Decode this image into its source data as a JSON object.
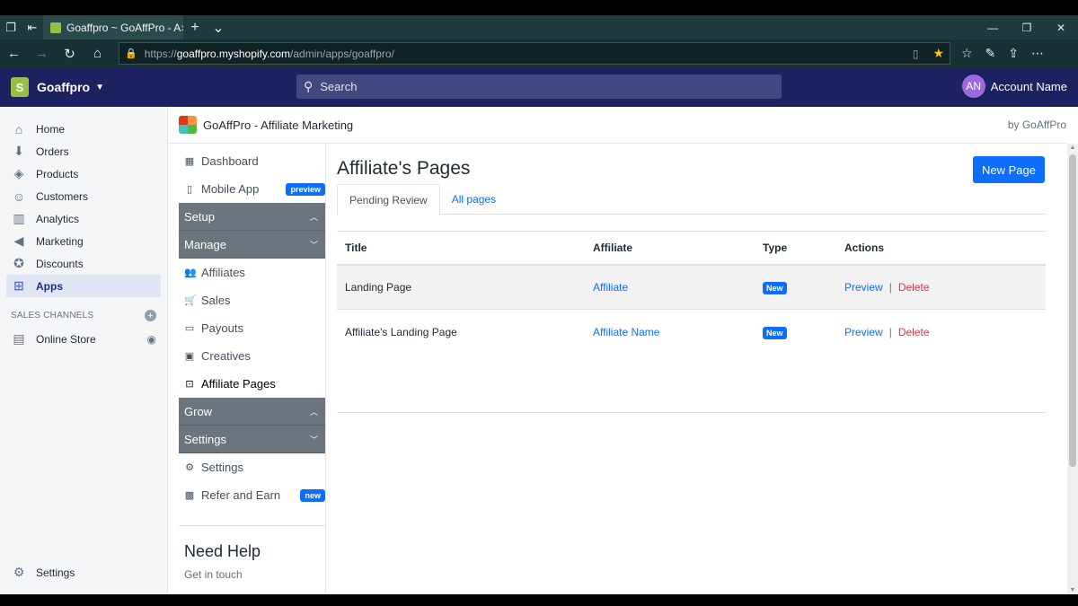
{
  "browser": {
    "tab_title": "Goaffpro ~ GoAffPro - A",
    "url_scheme": "https://",
    "url_host": "goaffpro.myshopify.com",
    "url_path": "/admin/apps/goaffpro/"
  },
  "shopify": {
    "store_name": "Goaffpro",
    "search_placeholder": "Search",
    "account_initials": "AN",
    "account_name": "Account Name"
  },
  "admin_nav": {
    "items": [
      {
        "label": "Home",
        "icon": "home-icon"
      },
      {
        "label": "Orders",
        "icon": "orders-icon"
      },
      {
        "label": "Products",
        "icon": "tag-icon"
      },
      {
        "label": "Customers",
        "icon": "person-icon"
      },
      {
        "label": "Analytics",
        "icon": "bar-chart-icon"
      },
      {
        "label": "Marketing",
        "icon": "megaphone-icon"
      },
      {
        "label": "Discounts",
        "icon": "discount-icon"
      },
      {
        "label": "Apps",
        "icon": "apps-icon"
      }
    ],
    "sales_channels_label": "SALES CHANNELS",
    "online_store_label": "Online Store",
    "settings_label": "Settings"
  },
  "app": {
    "title": "GoAffPro - Affiliate Marketing",
    "by": "by GoAffPro"
  },
  "subnav": {
    "dashboard": "Dashboard",
    "mobile_app": "Mobile App",
    "preview_badge": "preview",
    "setup": "Setup",
    "manage": "Manage",
    "affiliates": "Affiliates",
    "sales": "Sales",
    "payouts": "Payouts",
    "creatives": "Creatives",
    "affiliate_pages": "Affiliate Pages",
    "grow": "Grow",
    "settings_group": "Settings",
    "settings_item": "Settings",
    "refer_and_earn": "Refer and Earn",
    "new_badge": "new",
    "help_title": "Need Help",
    "help_subtitle": "Get in touch"
  },
  "page": {
    "title": "Affiliate's Pages",
    "new_page_button": "New Page",
    "tabs": [
      "Pending Review",
      "All pages"
    ],
    "columns": [
      "Title",
      "Affiliate",
      "Type",
      "Actions"
    ],
    "rows": [
      {
        "title": "Landing Page",
        "affiliate": "Affiliate",
        "type": "New",
        "preview": "Preview",
        "delete": "Delete"
      },
      {
        "title": "Affiliate's Landing Page",
        "affiliate": "Affiliate Name",
        "type": "New",
        "preview": "Preview",
        "delete": "Delete"
      }
    ],
    "action_separator": "|"
  }
}
